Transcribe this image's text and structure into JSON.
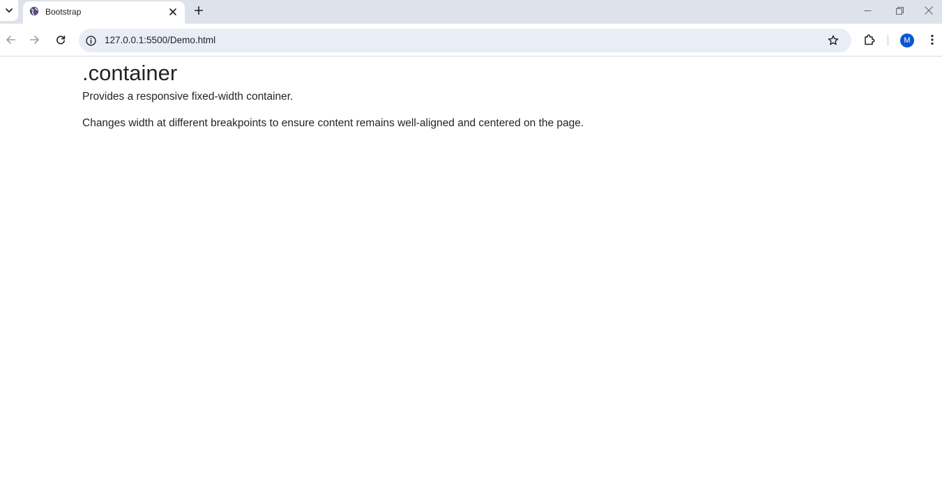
{
  "browser": {
    "tab": {
      "title": "Bootstrap"
    },
    "url": "127.0.0.1:5500/Demo.html",
    "profile_initial": "M",
    "accent": "#0b57d0"
  },
  "page": {
    "heading": ".container",
    "paragraphs": [
      "Provides a responsive fixed-width container.",
      "Changes width at different breakpoints to ensure content remains well-aligned and centered on the page."
    ]
  },
  "icons": {
    "tab_search": "chevron-down-icon",
    "favicon": "globe-icon",
    "tab_close": "close-icon",
    "new_tab": "plus-icon",
    "back": "arrow-left-icon",
    "forward": "arrow-right-icon",
    "reload": "reload-icon",
    "site_info": "info-icon",
    "bookmark": "star-icon",
    "extensions": "puzzle-icon",
    "menu": "kebab-menu-icon"
  }
}
